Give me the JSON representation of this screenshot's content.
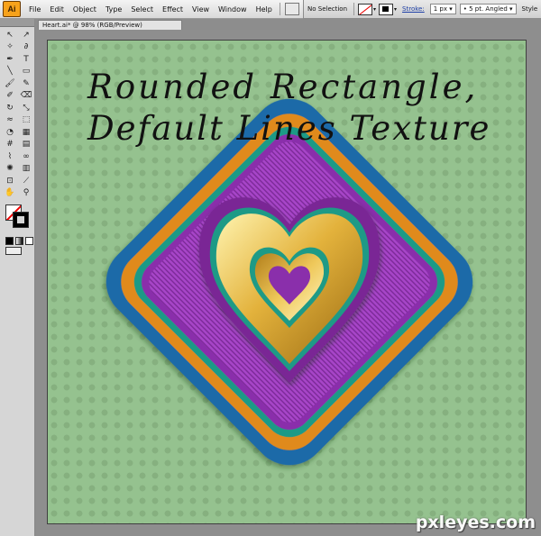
{
  "app": {
    "logo": "Ai"
  },
  "menu": [
    "File",
    "Edit",
    "Object",
    "Type",
    "Select",
    "Effect",
    "View",
    "Window",
    "Help"
  ],
  "control_bar": {
    "selection_status": "No Selection",
    "stroke_label": "Stroke:",
    "stroke_weight": "1 px",
    "brush": "5 pt. Angled",
    "style_label": "Style"
  },
  "document": {
    "tab_title": "Heart.ai* @ 98% (RGB/Preview)"
  },
  "tools": [
    {
      "name": "selection-tool-icon",
      "glyph": "↖"
    },
    {
      "name": "direct-selection-tool-icon",
      "glyph": "↗"
    },
    {
      "name": "magic-wand-tool-icon",
      "glyph": "✧"
    },
    {
      "name": "lasso-tool-icon",
      "glyph": "∂"
    },
    {
      "name": "pen-tool-icon",
      "glyph": "✒"
    },
    {
      "name": "type-tool-icon",
      "glyph": "T"
    },
    {
      "name": "line-tool-icon",
      "glyph": "╲"
    },
    {
      "name": "rectangle-tool-icon",
      "glyph": "▭"
    },
    {
      "name": "paintbrush-tool-icon",
      "glyph": "🖌"
    },
    {
      "name": "pencil-tool-icon",
      "glyph": "✎"
    },
    {
      "name": "blob-brush-tool-icon",
      "glyph": "✐"
    },
    {
      "name": "eraser-tool-icon",
      "glyph": "⌫"
    },
    {
      "name": "rotate-tool-icon",
      "glyph": "↻"
    },
    {
      "name": "scale-tool-icon",
      "glyph": "⤡"
    },
    {
      "name": "warp-tool-icon",
      "glyph": "≈"
    },
    {
      "name": "free-transform-tool-icon",
      "glyph": "⬚"
    },
    {
      "name": "shape-builder-tool-icon",
      "glyph": "◔"
    },
    {
      "name": "perspective-grid-tool-icon",
      "glyph": "▦"
    },
    {
      "name": "mesh-tool-icon",
      "glyph": "#"
    },
    {
      "name": "gradient-tool-icon",
      "glyph": "▤"
    },
    {
      "name": "eyedropper-tool-icon",
      "glyph": "⌇"
    },
    {
      "name": "blend-tool-icon",
      "glyph": "∞"
    },
    {
      "name": "symbol-sprayer-tool-icon",
      "glyph": "✺"
    },
    {
      "name": "column-graph-tool-icon",
      "glyph": "▥"
    },
    {
      "name": "artboard-tool-icon",
      "glyph": "⊡"
    },
    {
      "name": "slice-tool-icon",
      "glyph": "⟋"
    },
    {
      "name": "hand-tool-icon",
      "glyph": "✋"
    },
    {
      "name": "zoom-tool-icon",
      "glyph": "⚲"
    }
  ],
  "canvas_text": {
    "line1": "Rounded Rectangle,",
    "line2": "Default Lines Texture"
  },
  "watermark": "pxleyes.com",
  "colors": {
    "background_green": "#95c28f",
    "dots_green": "#86b07f",
    "outer_blue": "#1f6aa8",
    "orange": "#e08a1c",
    "teal": "#1e9a86",
    "purple": "#a341c4",
    "gold": "#e6b73a"
  }
}
